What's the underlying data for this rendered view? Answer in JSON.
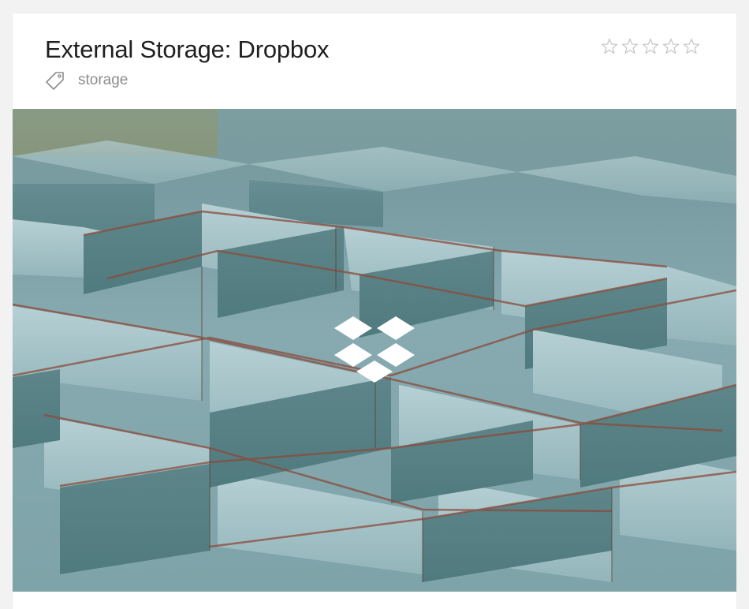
{
  "card": {
    "title": "External Storage: Dropbox",
    "tag": {
      "icon": "tag-icon",
      "label": "storage"
    },
    "rating": {
      "icon": "star-outline-icon",
      "max": 5,
      "value": 0
    },
    "hero": {
      "image": "teal-metal-grid-photo",
      "overlay_icon": "dropbox-logo-icon"
    }
  },
  "colors": {
    "title": "#1f1f1f",
    "muted_text": "#8d8d8d",
    "star_outline": "#c8c8c8",
    "photo_teal": "#8fb4ba",
    "rust": "#8b4a3a",
    "logo_white": "#ffffff"
  }
}
